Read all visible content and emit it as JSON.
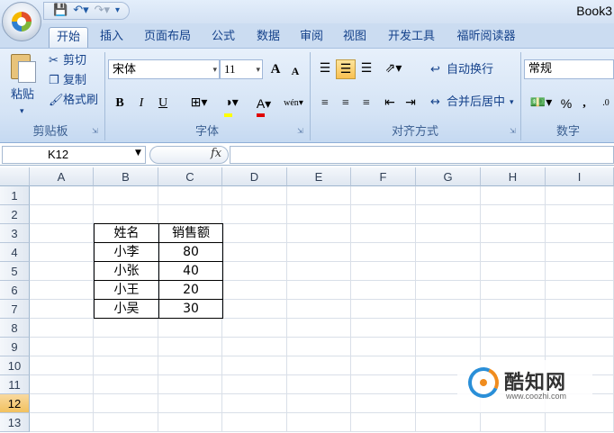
{
  "window": {
    "title": "Book3"
  },
  "qat": {
    "save_icon": "save-icon",
    "undo_icon": "undo-icon",
    "redo_icon": "redo-icon"
  },
  "tabs": [
    {
      "label": "开始",
      "active": true
    },
    {
      "label": "插入"
    },
    {
      "label": "页面布局"
    },
    {
      "label": "公式"
    },
    {
      "label": "数据"
    },
    {
      "label": "审阅"
    },
    {
      "label": "视图"
    },
    {
      "label": "开发工具"
    },
    {
      "label": "福昕阅读器"
    }
  ],
  "ribbon": {
    "clipboard": {
      "label": "剪贴板",
      "paste": "粘贴",
      "cut": "剪切",
      "copy": "复制",
      "format_painter": "格式刷"
    },
    "font": {
      "label": "字体",
      "font_name": "宋体",
      "font_size": "11",
      "grow": "A",
      "shrink": "A",
      "bold": "B",
      "italic": "I",
      "underline": "U",
      "phonetic": "wén"
    },
    "alignment": {
      "label": "对齐方式",
      "wrap_text": "自动换行",
      "merge_center": "合并后居中"
    },
    "number": {
      "label": "数字",
      "format": "常规",
      "percent": "%",
      "comma": ","
    }
  },
  "formula_bar": {
    "name_box": "K12",
    "fx": "fx",
    "formula": ""
  },
  "sheet": {
    "columns": [
      "A",
      "B",
      "C",
      "D",
      "E",
      "F",
      "G",
      "H",
      "I"
    ],
    "rows": [
      "1",
      "2",
      "3",
      "4",
      "5",
      "6",
      "7",
      "8",
      "9",
      "10",
      "11",
      "12",
      "13"
    ],
    "selected_row": "12",
    "table": {
      "headers": [
        "姓名",
        "销售额"
      ],
      "rows": [
        [
          "小李",
          "80"
        ],
        [
          "小张",
          "40"
        ],
        [
          "小王",
          "20"
        ],
        [
          "小吴",
          "30"
        ]
      ]
    }
  },
  "watermark": {
    "brand": "酷知网",
    "url": "www.coozhi.com"
  }
}
